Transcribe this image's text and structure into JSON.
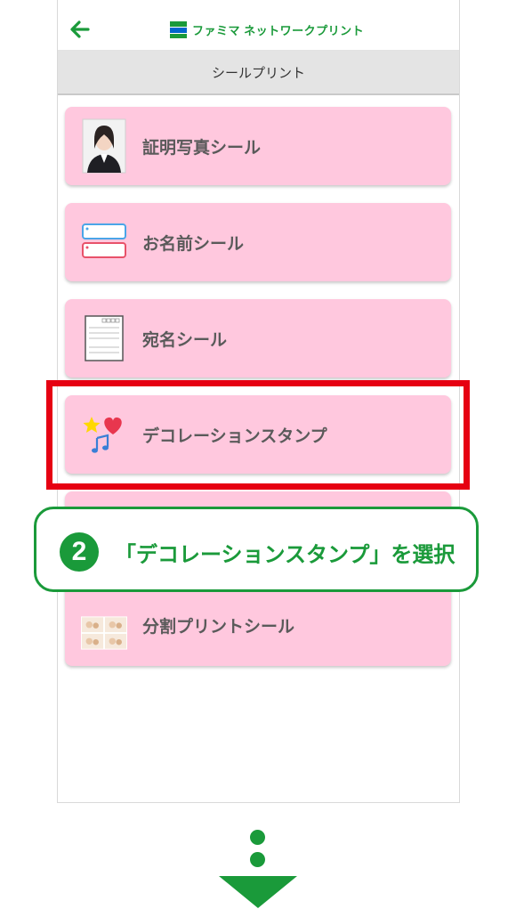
{
  "header": {
    "back_icon": "arrow-left-icon",
    "logo_text": "ファミマ ネットワークプリント",
    "logo_icon": "famima-logo-icon"
  },
  "section": {
    "title": "シールプリント"
  },
  "menu": {
    "items": [
      {
        "label": "証明写真シール",
        "icon": "id-photo-thumbnail"
      },
      {
        "label": "お名前シール",
        "icon": "name-label-thumbnail"
      },
      {
        "label": "宛名シール",
        "icon": "address-label-thumbnail"
      },
      {
        "label": "デコレーションスタンプ",
        "icon": "decoration-stamp-thumbnail"
      },
      {
        "label": "分割プリントシール",
        "icon": "split-print-thumbnail"
      }
    ]
  },
  "callout": {
    "step": "2",
    "text": "「デコレーションスタンプ」を選択"
  },
  "colors": {
    "brand_green": "#1a9a3a",
    "item_pink": "#ffc8de",
    "highlight_red": "#e60012",
    "section_gray": "#e4e4e4"
  }
}
